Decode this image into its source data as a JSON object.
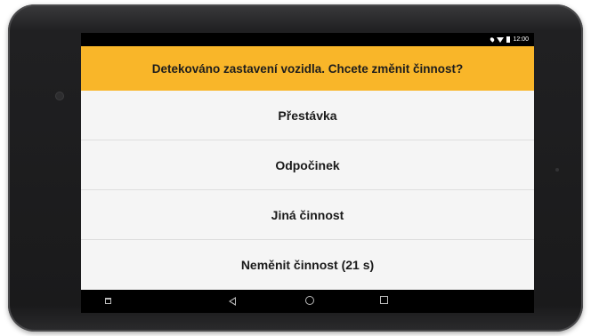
{
  "status_bar": {
    "time": "12:00"
  },
  "dialog": {
    "title": "Detekováno zastavení vozidla. Chcete změnit činnost?",
    "options": [
      {
        "label": "Přestávka"
      },
      {
        "label": "Odpočinek"
      },
      {
        "label": "Jiná činnost"
      },
      {
        "label": "Neměnit činnost (21 s)"
      }
    ]
  },
  "colors": {
    "header": "#f9b629",
    "background": "#f5f5f5",
    "navbar": "#000000"
  },
  "navigation_bar": {
    "icons": [
      "minimize-icon",
      "back-icon",
      "home-icon",
      "recent-apps-icon"
    ]
  }
}
